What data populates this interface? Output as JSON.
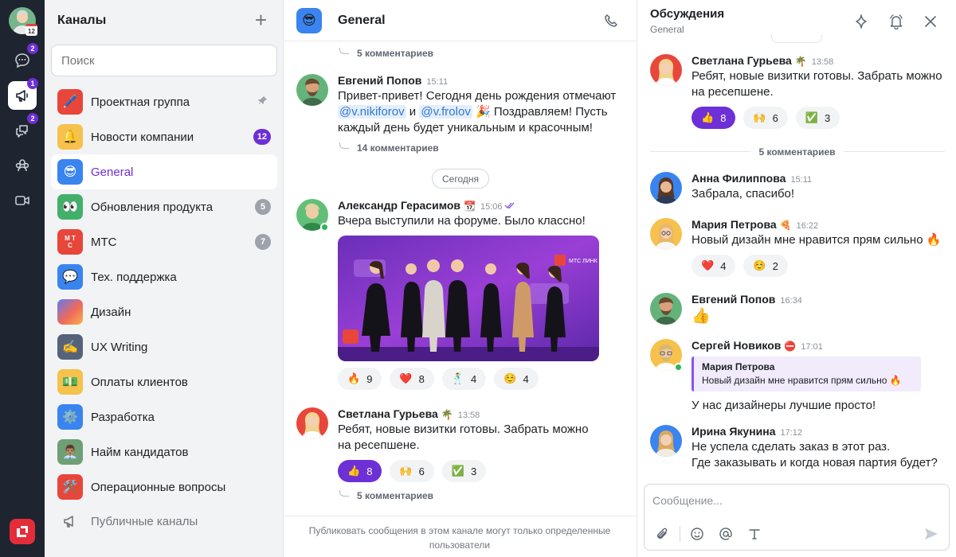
{
  "rail": {
    "badges": {
      "chats": "2",
      "channels": "1",
      "threads": "2"
    },
    "calendar_day": "12"
  },
  "channels_panel": {
    "title": "Каналы",
    "search_placeholder": "Поиск",
    "items": [
      {
        "label": "Проектная группа",
        "icon": "pen-icon",
        "color": "#e8463b",
        "pinned": true
      },
      {
        "label": "Новости компании",
        "icon": "bell-icon",
        "color": "#f6c14c",
        "count": "12",
        "hot": true
      },
      {
        "label": "General",
        "icon": "sunglasses-icon",
        "color": "#3a84f0",
        "active": true
      },
      {
        "label": "Обновления продукта",
        "icon": "eyes-icon",
        "color": "#43b06a",
        "count": "5"
      },
      {
        "label": "МТС",
        "icon": "mts-icon",
        "color": "#e8463b",
        "count": "7"
      },
      {
        "label": "Тех. поддержка",
        "icon": "speech-icon",
        "color": "#3a84f0"
      },
      {
        "label": "Дизайн",
        "icon": "gradient-icon",
        "color": "#f0695b"
      },
      {
        "label": "UX Writing",
        "icon": "writing-hand-icon",
        "color": "#56627a"
      },
      {
        "label": "Оплаты клиентов",
        "icon": "money-icon",
        "color": "#f6c14c"
      },
      {
        "label": "Разработка",
        "icon": "gear-icon",
        "color": "#3a84f0"
      },
      {
        "label": "Найм кандидатов",
        "icon": "person-icon",
        "color": "#6f9f75"
      },
      {
        "label": "Операционные вопросы",
        "icon": "tools-icon",
        "color": "#e8463b"
      }
    ],
    "public_label": "Публичные каналы"
  },
  "chat": {
    "title": "General",
    "top_thread": "5 комментариев",
    "messages": [
      {
        "author": "Евгений Попов",
        "time": "15:11",
        "text_a": "Привет-привет! Сегодня день рождения отмечают ",
        "mention1": "@v.nikiforov",
        "and": " и ",
        "mention2": "@v.frolov",
        "text_b": " 🎉 Поздравляем! Пусть каждый день будет уникальным и красочным!",
        "thread": "14 комментариев"
      },
      {
        "author": "Александр Герасимов",
        "time": "15:06",
        "text": "Вчера выступили на форуме. Было классно!",
        "reactions": [
          {
            "emoji": "🔥",
            "count": "9"
          },
          {
            "emoji": "❤️",
            "count": "8"
          },
          {
            "emoji": "🕺",
            "count": "4"
          },
          {
            "emoji": "☺️",
            "count": "4"
          }
        ]
      },
      {
        "author": "Светлана Гурьева",
        "time": "13:58",
        "status": "🌴",
        "text": "Ребят, новые визитки готовы. Забрать можно на ресепшене.",
        "reactions": [
          {
            "emoji": "👍",
            "count": "8",
            "on": true
          },
          {
            "emoji": "🙌",
            "count": "6"
          },
          {
            "emoji": "✅",
            "count": "3"
          }
        ],
        "thread": "5 комментариев"
      }
    ],
    "day_label": "Сегодня",
    "photo_sign": "МТС ЛИНК",
    "footer": "Публиковать сообщения в этом канале могут только определенные пользователи"
  },
  "discussion": {
    "title": "Обсуждения",
    "subtitle": "General",
    "root": {
      "author": "Светлана Гурьева",
      "status": "🌴",
      "time": "13:58",
      "text": "Ребят, новые визитки готовы. Забрать можно на ресепшене.",
      "reactions": [
        {
          "emoji": "👍",
          "count": "8",
          "on": true
        },
        {
          "emoji": "🙌",
          "count": "6"
        },
        {
          "emoji": "✅",
          "count": "3"
        }
      ]
    },
    "divider": "5 комментариев",
    "replies": [
      {
        "author": "Анна Филиппова",
        "time": "15:11",
        "text": "Забрала, спасибо!"
      },
      {
        "author": "Мария Петрова",
        "status": "🍕",
        "time": "16:22",
        "text": "Новый дизайн мне нравится прям сильно 🔥",
        "reactions": [
          {
            "emoji": "❤️",
            "count": "4"
          },
          {
            "emoji": "☺️",
            "count": "2"
          }
        ]
      },
      {
        "author": "Евгений Попов",
        "time": "16:34",
        "text": "👍"
      },
      {
        "author": "Сергей Новиков",
        "status": "⛔",
        "time": "17:01",
        "quote_author": "Мария Петрова",
        "quote_text": "Новый дизайн мне нравится прям сильно 🔥",
        "text": "У нас дизайнеры лучшие просто!"
      },
      {
        "author": "Ирина Якунина",
        "time": "17:12",
        "text1": "Не успела сделать заказ в этот раз.",
        "text2": "Где заказывать и когда новая партия будет?"
      }
    ],
    "composer_placeholder": "Сообщение..."
  }
}
